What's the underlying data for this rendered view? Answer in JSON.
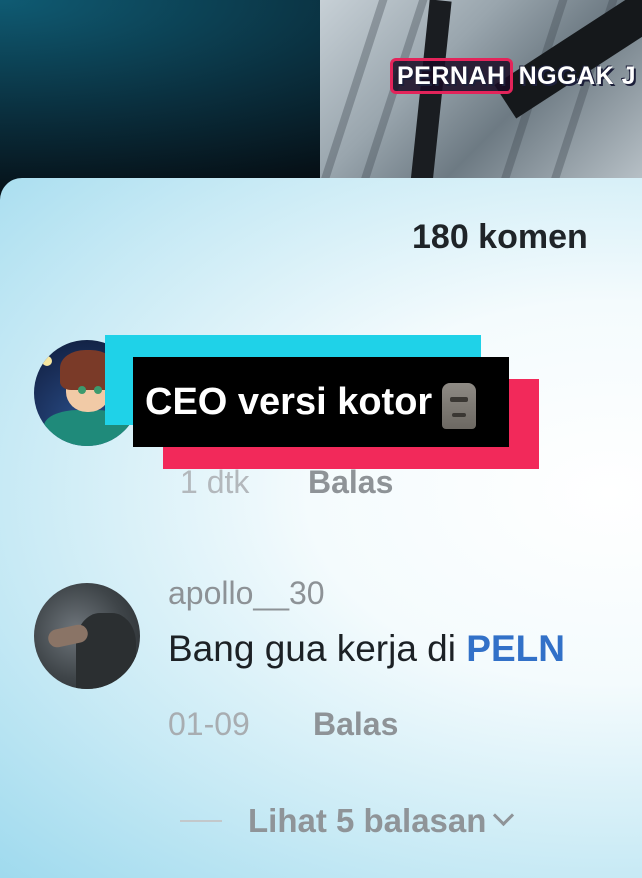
{
  "video": {
    "caption_highlight": "PERNAH",
    "caption_rest": "NGGAK J"
  },
  "sheet": {
    "comment_count": "180 komen"
  },
  "sticker": {
    "text": "CEO versi kotor",
    "emoji_icon": "moai-icon"
  },
  "comments": [
    {
      "time": "1 dtk",
      "reply_label": "Balas"
    },
    {
      "username": "apollo__30",
      "text": "Bang gua kerja di ",
      "mention": "PELN",
      "time": "01-09",
      "reply_label": "Balas",
      "view_replies": "Lihat 5 balasan"
    }
  ],
  "colors": {
    "mention": "#3271c8",
    "sticker_cyan": "#1fd2e8",
    "sticker_pink": "#f2295a"
  }
}
